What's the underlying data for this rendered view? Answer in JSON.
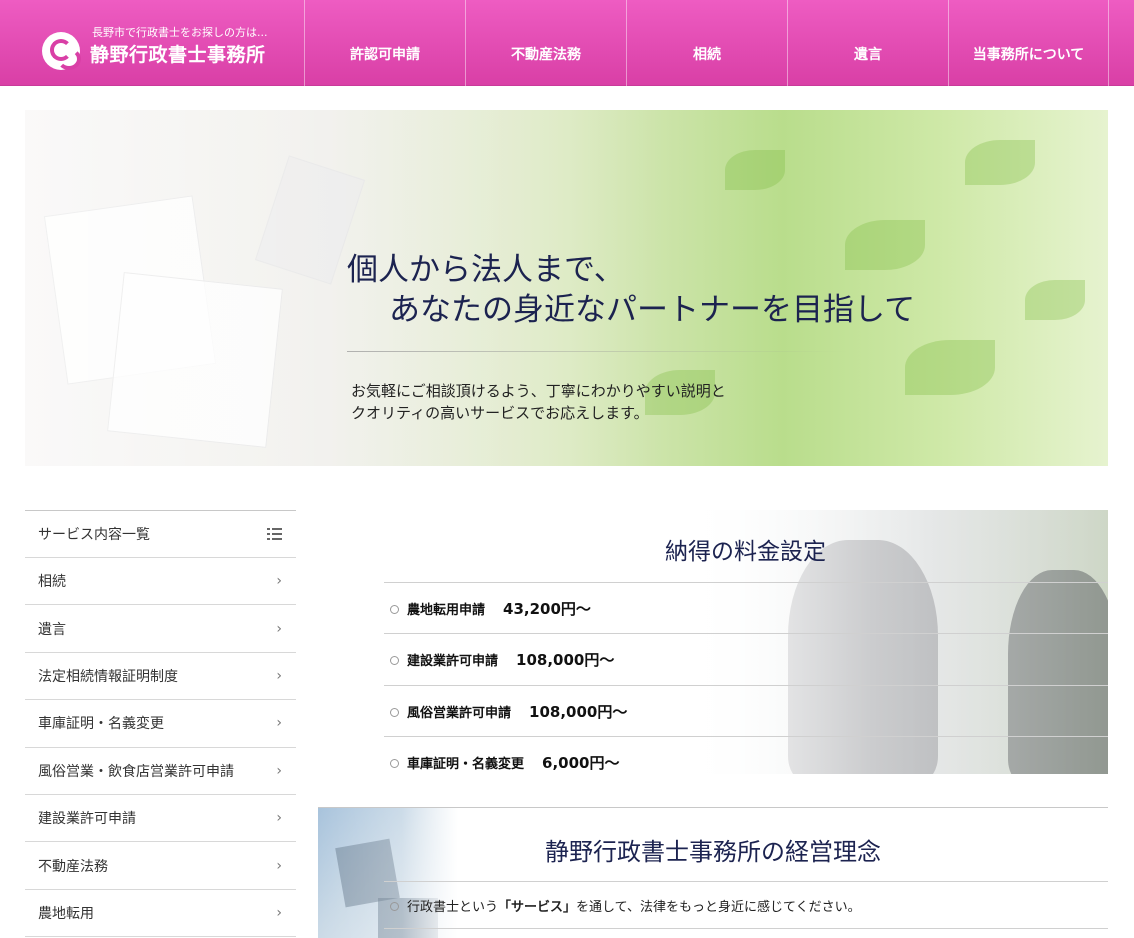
{
  "header": {
    "tagline": "長野市で行政書士をお探しの方は...",
    "site_name": "静野行政書士事務所",
    "nav": [
      "許認可申請",
      "不動産法務",
      "相続",
      "遺言",
      "当事務所について"
    ]
  },
  "hero": {
    "title_line1": "個人から法人まで、",
    "title_line2": "あなたの身近なパートナーを目指して",
    "sub_line1": "お気軽にご相談頂けるよう、丁寧にわかりやすい説明と",
    "sub_line2": "クオリティの高いサービスでお応えします。"
  },
  "sidebar": {
    "heading": "サービス内容一覧",
    "heading_icon": "list-icon",
    "items": [
      "相続",
      "遺言",
      "法定相続情報証明制度",
      "車庫証明・名義変更",
      "風俗営業・飲食店営業許可申請",
      "建設業許可申請",
      "不動産法務",
      "農地転用"
    ]
  },
  "pricing": {
    "title": "納得の料金設定",
    "rows": [
      {
        "name": "農地転用申請",
        "price": "43,200円～"
      },
      {
        "name": "建設業許可申請",
        "price": "108,000円～"
      },
      {
        "name": "風俗営業許可申請",
        "price": "108,000円～"
      },
      {
        "name": "車庫証明・名義変更",
        "price": "6,000円～"
      }
    ]
  },
  "philosophy": {
    "title": "静野行政書士事務所の経営理念",
    "line_before": "行政書士という",
    "line_bold": "「サービス」",
    "line_after": "を通して、法律をもっと身近に感じてください。"
  },
  "colors": {
    "header_pink": "#e04eb4",
    "heading_navy": "#1c2350"
  }
}
